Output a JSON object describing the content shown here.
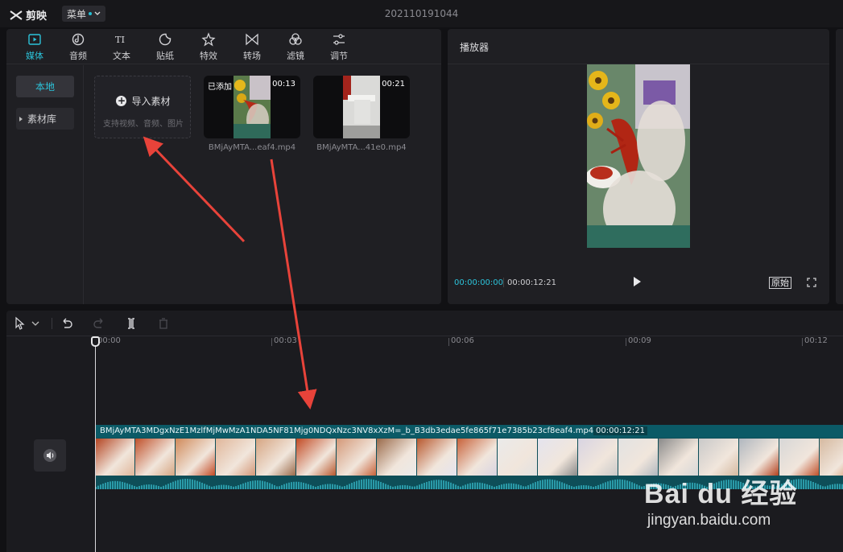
{
  "app": {
    "name": "剪映",
    "menu_label": "菜单",
    "project_title": "202110191044"
  },
  "media_tabs": [
    {
      "label": "媒体",
      "icon": "media-icon",
      "active": true
    },
    {
      "label": "音频",
      "icon": "audio-icon",
      "active": false
    },
    {
      "label": "文本",
      "icon": "text-icon",
      "active": false
    },
    {
      "label": "贴纸",
      "icon": "sticker-icon",
      "active": false
    },
    {
      "label": "特效",
      "icon": "effects-icon",
      "active": false
    },
    {
      "label": "转场",
      "icon": "transition-icon",
      "active": false
    },
    {
      "label": "滤镜",
      "icon": "filter-icon",
      "active": false
    },
    {
      "label": "调节",
      "icon": "adjust-icon",
      "active": false
    }
  ],
  "sidebar": {
    "items": [
      {
        "label": "本地",
        "active": true
      },
      {
        "label": "素材库",
        "active": false
      }
    ]
  },
  "import": {
    "title": "导入素材",
    "hint": "支持视频、音频、图片"
  },
  "clips": [
    {
      "name": "BMjAyMTA...eaf4.mp4",
      "duration": "00:13",
      "badge": "已添加"
    },
    {
      "name": "BMjAyMTA...41e0.mp4",
      "duration": "00:21",
      "badge": ""
    }
  ],
  "player": {
    "title": "播放器",
    "current_time": "00:00:00:00",
    "total_time": "00:00:12:21",
    "original_label": "原始"
  },
  "timeline": {
    "ticks": [
      "00:00",
      "00:03",
      "00:06",
      "00:09",
      "00:12"
    ],
    "track_name": "BMjAyMTA3MDgxNzE1MzlfMjMwMzA1NDA5NF81Mjg0NDQxNzc3NV8xXzM=_b_B3db3edae5fe865f71e7385b23cf8eaf4.mp4",
    "track_duration": "00:00:12:21"
  },
  "colors": {
    "accent": "#2cc3da",
    "annotation_arrow": "#e8433a",
    "track_bg": "#0e4e58"
  },
  "watermark": {
    "brand": "Bai du 经验",
    "url": "jingyan.baidu.com"
  }
}
